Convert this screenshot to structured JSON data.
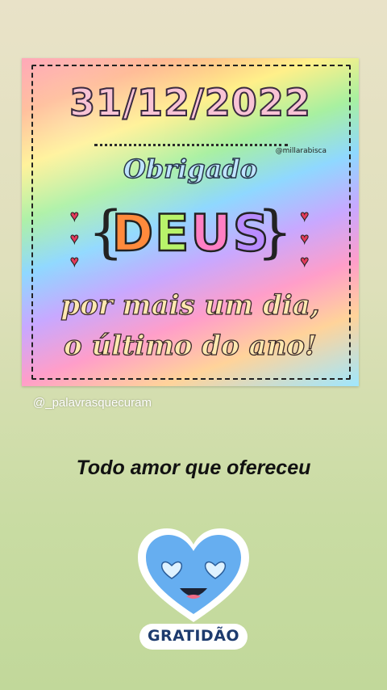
{
  "post": {
    "image": {
      "date": "31/12/2022",
      "thanks": "Obrigado",
      "watermark": "@millarabisca",
      "god_letters": [
        "D",
        "E",
        "U",
        "S"
      ],
      "god_letter_colors": [
        "#ff8a3c",
        "#b8f36a",
        "#ff7fc4",
        "#b98cff"
      ],
      "line1": "por mais um dia,",
      "line2": "o último do ano!"
    },
    "credit": "@_palavrasquecuram",
    "caption": "Todo amor que ofereceu"
  },
  "sticker": {
    "label": "GRATIDÃO",
    "heart_color": "#66aef0",
    "icon": "heart-eyes-face-icon"
  }
}
